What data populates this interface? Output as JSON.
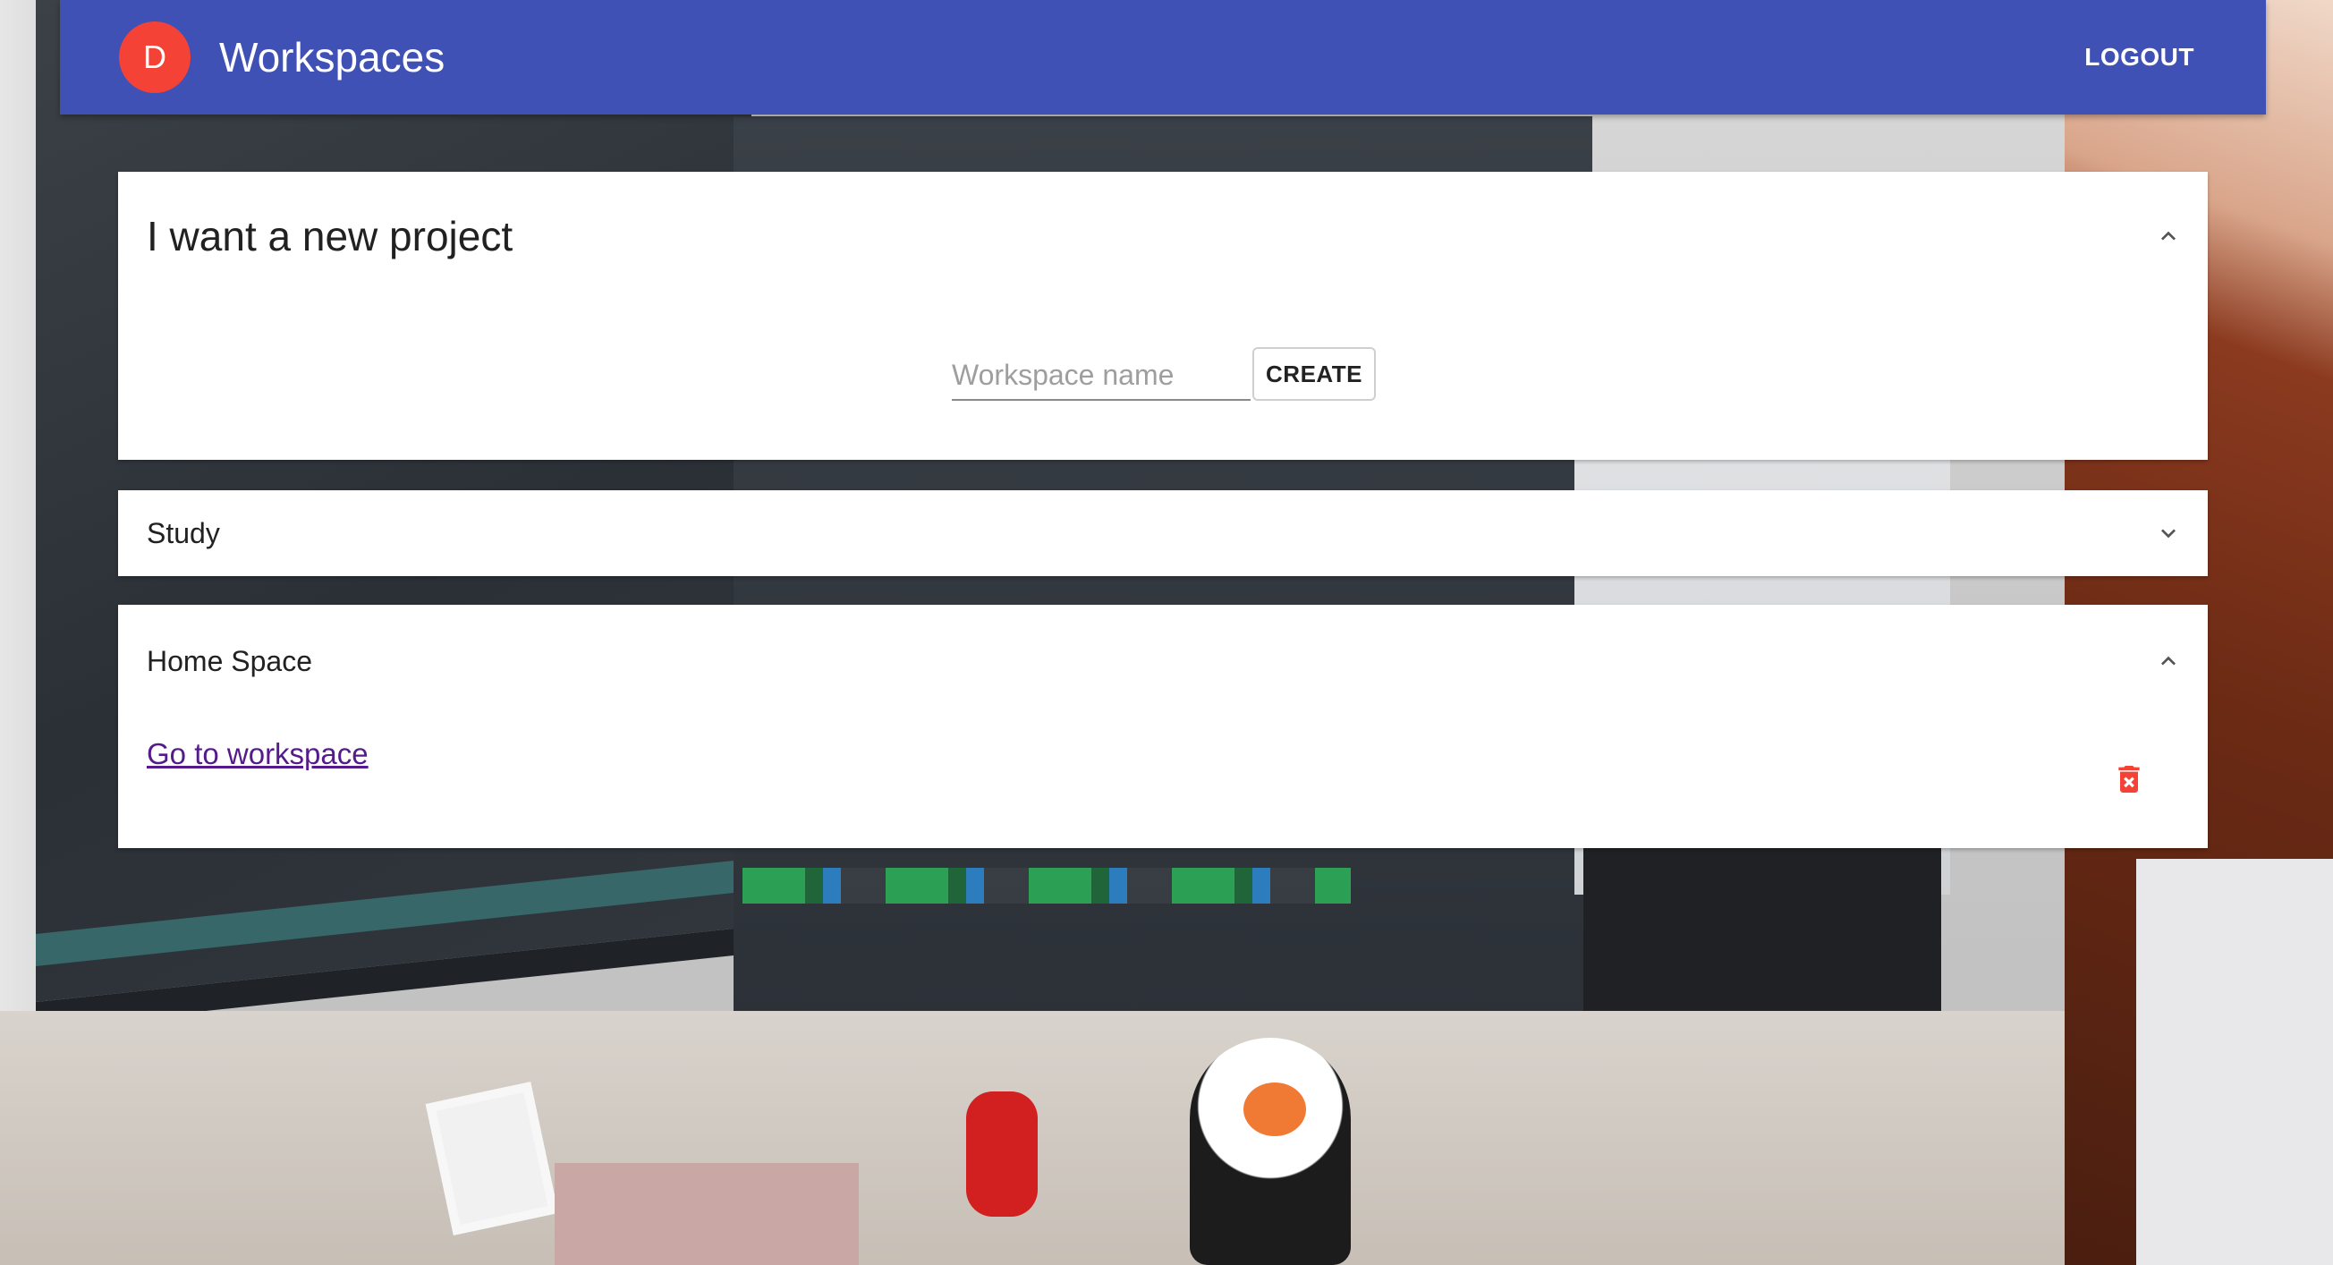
{
  "app": {
    "avatar_letter": "D",
    "title": "Workspaces",
    "logout_label": "LOGOUT"
  },
  "new_project": {
    "title": "I want a new project",
    "input_placeholder": "Workspace name",
    "input_value": "",
    "create_label": "CREATE",
    "expanded": true
  },
  "workspaces": [
    {
      "name": "Study",
      "expanded": false
    },
    {
      "name": "Home Space",
      "expanded": true,
      "link_label": "Go to workspace",
      "delete_icon": "delete-forever-icon"
    }
  ],
  "colors": {
    "appbar": "#3f51b5",
    "avatar": "#f44336",
    "delete_icon": "#f44336",
    "link": "#551a8b"
  }
}
